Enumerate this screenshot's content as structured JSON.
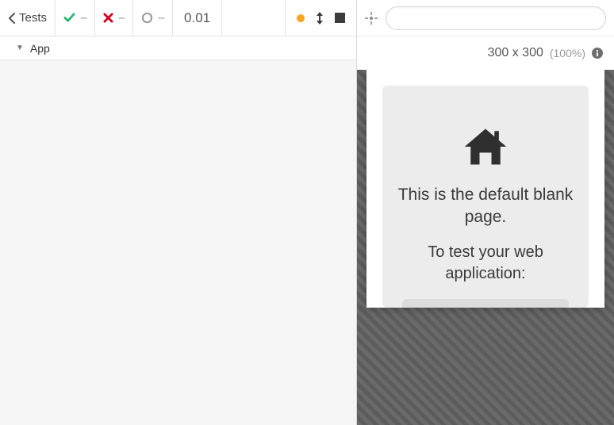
{
  "toolbar": {
    "back_label": "Tests",
    "pass_value": "--",
    "fail_value": "--",
    "pending_value": "--",
    "time": "0.01"
  },
  "spec": {
    "name": "App"
  },
  "browser": {
    "url": "",
    "dimensions": "300 x 300",
    "zoom": "(100%)"
  },
  "preview": {
    "line1": "This is the default blank page.",
    "line2": "To test your web application:"
  }
}
